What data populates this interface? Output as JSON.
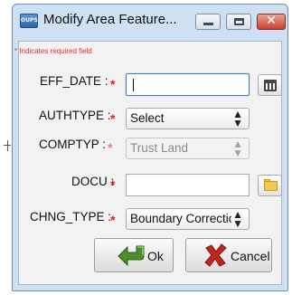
{
  "window": {
    "app_icon_text": "OUPS",
    "title": "Modify Area Feature...",
    "controls": {
      "minimize": "minimize-icon",
      "maximize": "maximize-icon",
      "close": "✕"
    }
  },
  "form": {
    "required_note": "* Indicates required field",
    "required_marker": "*",
    "fields": [
      {
        "label": "EFF_DATE :",
        "type": "text",
        "value": "",
        "side_icon": "calendar-icon"
      },
      {
        "label": "AUTHTYPE :",
        "type": "select",
        "value": "Select"
      },
      {
        "label": "COMPTYP :",
        "type": "select",
        "value": "Trust Land",
        "disabled": true
      },
      {
        "label": "DOCU :",
        "type": "text",
        "value": "",
        "side_icon": "folder-icon"
      },
      {
        "label": "CHNG_TYPE :",
        "type": "select",
        "value": "Boundary Correction"
      }
    ]
  },
  "buttons": {
    "ok": "Ok",
    "cancel": "Cancel"
  },
  "colors": {
    "required": "#e02020",
    "title_bar": "#cfe0f2",
    "close_button": "#c8412f",
    "ok_icon": "#4a8f2a",
    "cancel_icon": "#c0281c"
  }
}
